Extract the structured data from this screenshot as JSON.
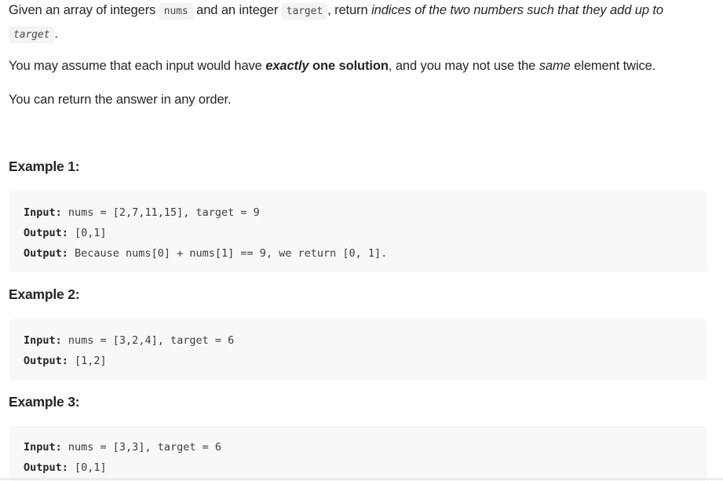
{
  "description": {
    "p1": {
      "t1": "Given an array of integers ",
      "code1": "nums",
      "t2": " and an integer ",
      "code2": "target",
      "t3": ", return ",
      "em": "indices of the two numbers such that they add up to",
      "t4": " ",
      "code3": "target",
      "t5": "."
    },
    "p2": {
      "t1": "You may assume that each input would have ",
      "strong_em": "exactly",
      "strong": " one solution",
      "t2": ", and you may not use the ",
      "em": "same",
      "t3": " element twice."
    },
    "p3": "You can return the answer in any order."
  },
  "examples": [
    {
      "title": "Example 1:",
      "lines": [
        {
          "label": "Input:",
          "value": " nums = [2,7,11,15], target = 9"
        },
        {
          "label": "Output:",
          "value": " [0,1]"
        },
        {
          "label": "Output:",
          "value": " Because nums[0] + nums[1] == 9, we return [0, 1]."
        }
      ]
    },
    {
      "title": "Example 2:",
      "lines": [
        {
          "label": "Input:",
          "value": " nums = [3,2,4], target = 6"
        },
        {
          "label": "Output:",
          "value": " [1,2]"
        }
      ]
    },
    {
      "title": "Example 3:",
      "lines": [
        {
          "label": "Input:",
          "value": " nums = [3,3], target = 6"
        },
        {
          "label": "Output:",
          "value": " [0,1]"
        }
      ]
    }
  ]
}
